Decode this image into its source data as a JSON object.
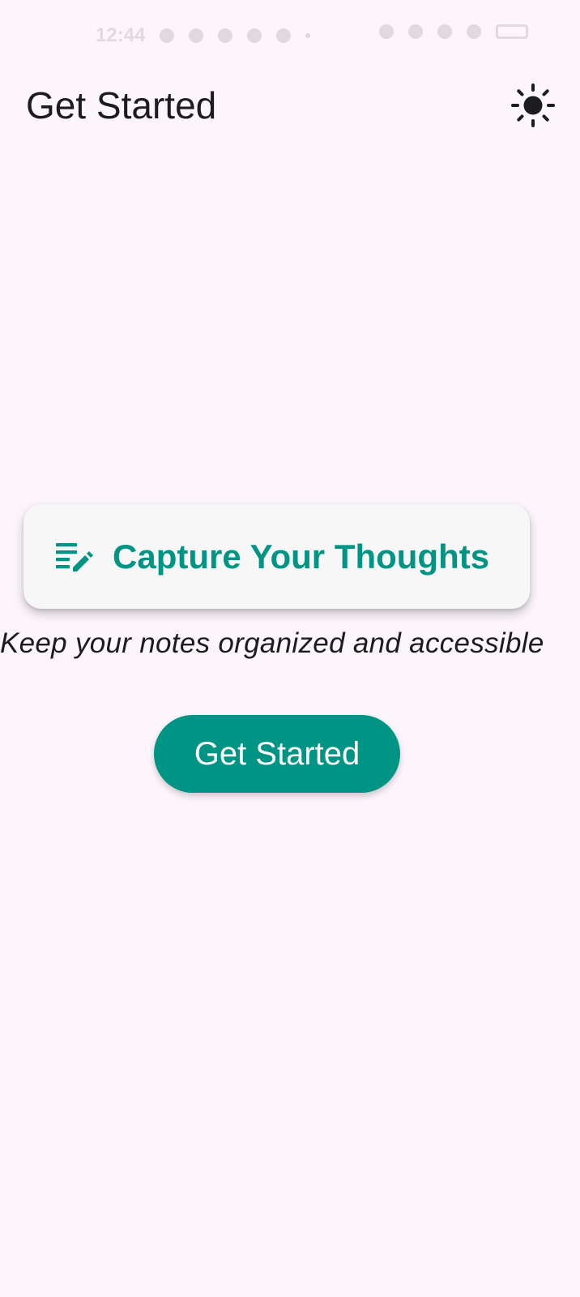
{
  "status_bar": {
    "time": "12:44"
  },
  "app_bar": {
    "title": "Get Started",
    "theme_toggle_icon": "sun-icon"
  },
  "hero": {
    "icon": "edit-note-icon",
    "title": "Capture Your Thoughts",
    "subtitle": "Keep your notes organized and accessible"
  },
  "cta": {
    "label": "Get Started"
  },
  "colors": {
    "accent": "#009485",
    "background": "#FCF6FC",
    "card": "#F7F7F7",
    "text": "#1C1B1F"
  }
}
